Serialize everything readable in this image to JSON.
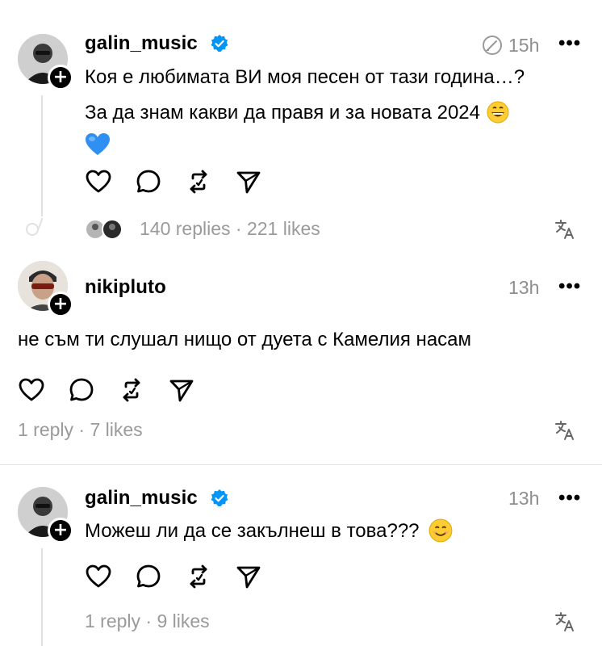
{
  "posts": [
    {
      "username": "galin_music",
      "verified": true,
      "time": "15h",
      "line1": "Коя е любимата ВИ моя песен от тази година…?",
      "line2": "За да знам какви да правя и за новата 2024",
      "stats": "140 replies · 221 likes"
    },
    {
      "username": "nikipluto",
      "verified": false,
      "time": "13h",
      "line1": "не съм ти слушал нищо от дуета с Камелия насам",
      "stats": "1 reply · 7 likes"
    },
    {
      "username": "galin_music",
      "verified": true,
      "time": "13h",
      "line1": "Можеш ли да се закълнеш в това???",
      "stats": "1 reply · 9 likes"
    }
  ],
  "more_label": "•••",
  "colors": {
    "verified": "#0095f6",
    "muted": "#8e8e8e"
  }
}
